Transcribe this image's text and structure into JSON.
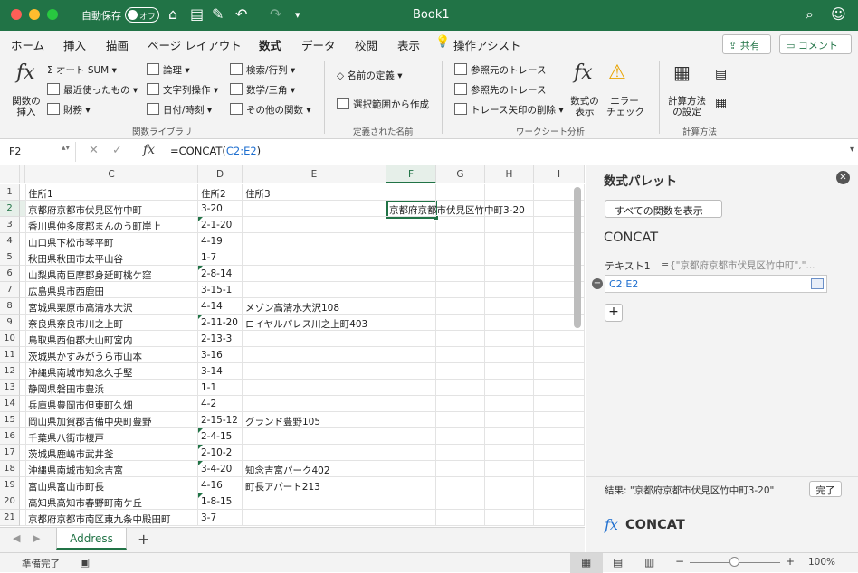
{
  "titlebar": {
    "autosave_label": "自動保存",
    "autosave_state": "オフ",
    "title": "Book1",
    "bg_color": "#217346"
  },
  "menu_tabs": [
    "ホーム",
    "挿入",
    "描画",
    "ページ レイアウト",
    "数式",
    "データ",
    "校閲",
    "表示"
  ],
  "active_tab": "数式",
  "assist": "操作アシスト",
  "share_label": "共有",
  "comment_label": "コメント",
  "ribbon": {
    "insert_func": "関数の\n挿入",
    "autosum": "オート SUM",
    "recent": "最近使ったもの",
    "financial": "財務",
    "logical": "論理",
    "text": "文字列操作",
    "datetime": "日付/時刻",
    "lookup": "検索/行列",
    "math": "数学/三角",
    "more": "その他の関数",
    "group_funclib": "関数ライブラリ",
    "define_name": "名前の定義",
    "create_from_sel": "選択範囲から作成",
    "group_names": "定義された名前",
    "trace_precedents": "参照元のトレース",
    "trace_dependents": "参照先のトレース",
    "remove_arrows": "トレース矢印の削除",
    "show_formulas": "数式の\n表示",
    "error_check": "エラー\nチェック",
    "group_audit": "ワークシート分析",
    "calc_options": "計算方法\nの設定",
    "group_calc": "計算方法"
  },
  "formula_bar": {
    "name_box": "F2",
    "formula_prefix": "=CONCAT(",
    "formula_ref": "C2:E2",
    "formula_suffix": ")"
  },
  "columns": [
    "C",
    "D",
    "E",
    "F",
    "G",
    "H",
    "I"
  ],
  "rows": [
    {
      "n": "1",
      "c": "住所1",
      "d": "住所2",
      "e": "住所3",
      "tri": false
    },
    {
      "n": "2",
      "c": "京都府京都市伏見区竹中町",
      "d": "3-20",
      "e": "",
      "tri": false
    },
    {
      "n": "3",
      "c": "香川県仲多度郡まんのう町岸上",
      "d": "2-1-20",
      "e": "",
      "tri": true
    },
    {
      "n": "4",
      "c": "山口県下松市琴平町",
      "d": "4-19",
      "e": "",
      "tri": false
    },
    {
      "n": "5",
      "c": "秋田県秋田市太平山谷",
      "d": "1-7",
      "e": "",
      "tri": false
    },
    {
      "n": "6",
      "c": "山梨県南巨摩郡身延町桃ケ窪",
      "d": "2-8-14",
      "e": "",
      "tri": true
    },
    {
      "n": "7",
      "c": "広島県呉市西鹿田",
      "d": "3-15-1",
      "e": "",
      "tri": false
    },
    {
      "n": "8",
      "c": "宮城県栗原市高清水大沢",
      "d": "4-14",
      "e": "メゾン高清水大沢108",
      "tri": false
    },
    {
      "n": "9",
      "c": "奈良県奈良市川之上町",
      "d": "2-11-20",
      "e": "ロイヤルパレス川之上町403",
      "tri": true
    },
    {
      "n": "10",
      "c": "鳥取県西伯郡大山町宮内",
      "d": "2-13-3",
      "e": "",
      "tri": false
    },
    {
      "n": "11",
      "c": "茨城県かすみがうら市山本",
      "d": "3-16",
      "e": "",
      "tri": false
    },
    {
      "n": "12",
      "c": "沖縄県南城市知念久手堅",
      "d": "3-14",
      "e": "",
      "tri": false
    },
    {
      "n": "13",
      "c": "静岡県磐田市豊浜",
      "d": "1-1",
      "e": "",
      "tri": false
    },
    {
      "n": "14",
      "c": "兵庫県豊岡市但東町久畑",
      "d": "4-2",
      "e": "",
      "tri": false
    },
    {
      "n": "15",
      "c": "岡山県加賀郡吉備中央町豊野",
      "d": "2-15-12",
      "e": "グランド豊野105",
      "tri": false
    },
    {
      "n": "16",
      "c": "千葉県八街市榎戸",
      "d": "2-4-15",
      "e": "",
      "tri": true
    },
    {
      "n": "17",
      "c": "茨城県鹿嶋市武井釜",
      "d": "2-10-2",
      "e": "",
      "tri": true
    },
    {
      "n": "18",
      "c": "沖縄県南城市知念吉富",
      "d": "3-4-20",
      "e": "知念吉富パーク402",
      "tri": true
    },
    {
      "n": "19",
      "c": "富山県富山市町長",
      "d": "4-16",
      "e": "町長アパート213",
      "tri": false
    },
    {
      "n": "20",
      "c": "高知県高知市春野町南ケ丘",
      "d": "1-8-15",
      "e": "",
      "tri": true
    },
    {
      "n": "21",
      "c": "京都府京都市南区東九条中殿田町",
      "d": "3-7",
      "e": "",
      "tri": false
    }
  ],
  "f2_value": "京都府京都市伏見区竹中町3-20",
  "sheet_tab": "Address",
  "panel": {
    "title": "数式パレット",
    "show_all": "すべての関数を表示",
    "func_name": "CONCAT",
    "arg_label": "テキスト1",
    "arg_eq": "=",
    "arg_preview": "{\"京都府京都市伏見区竹中町\",\"...",
    "arg_value": "C2:E2",
    "result_label": "結果: \"京都府京都市伏見区竹中町3-20\"",
    "done_label": "完了",
    "footer_func": "CONCAT"
  },
  "status": {
    "ready": "準備完了",
    "zoom": "100%"
  }
}
